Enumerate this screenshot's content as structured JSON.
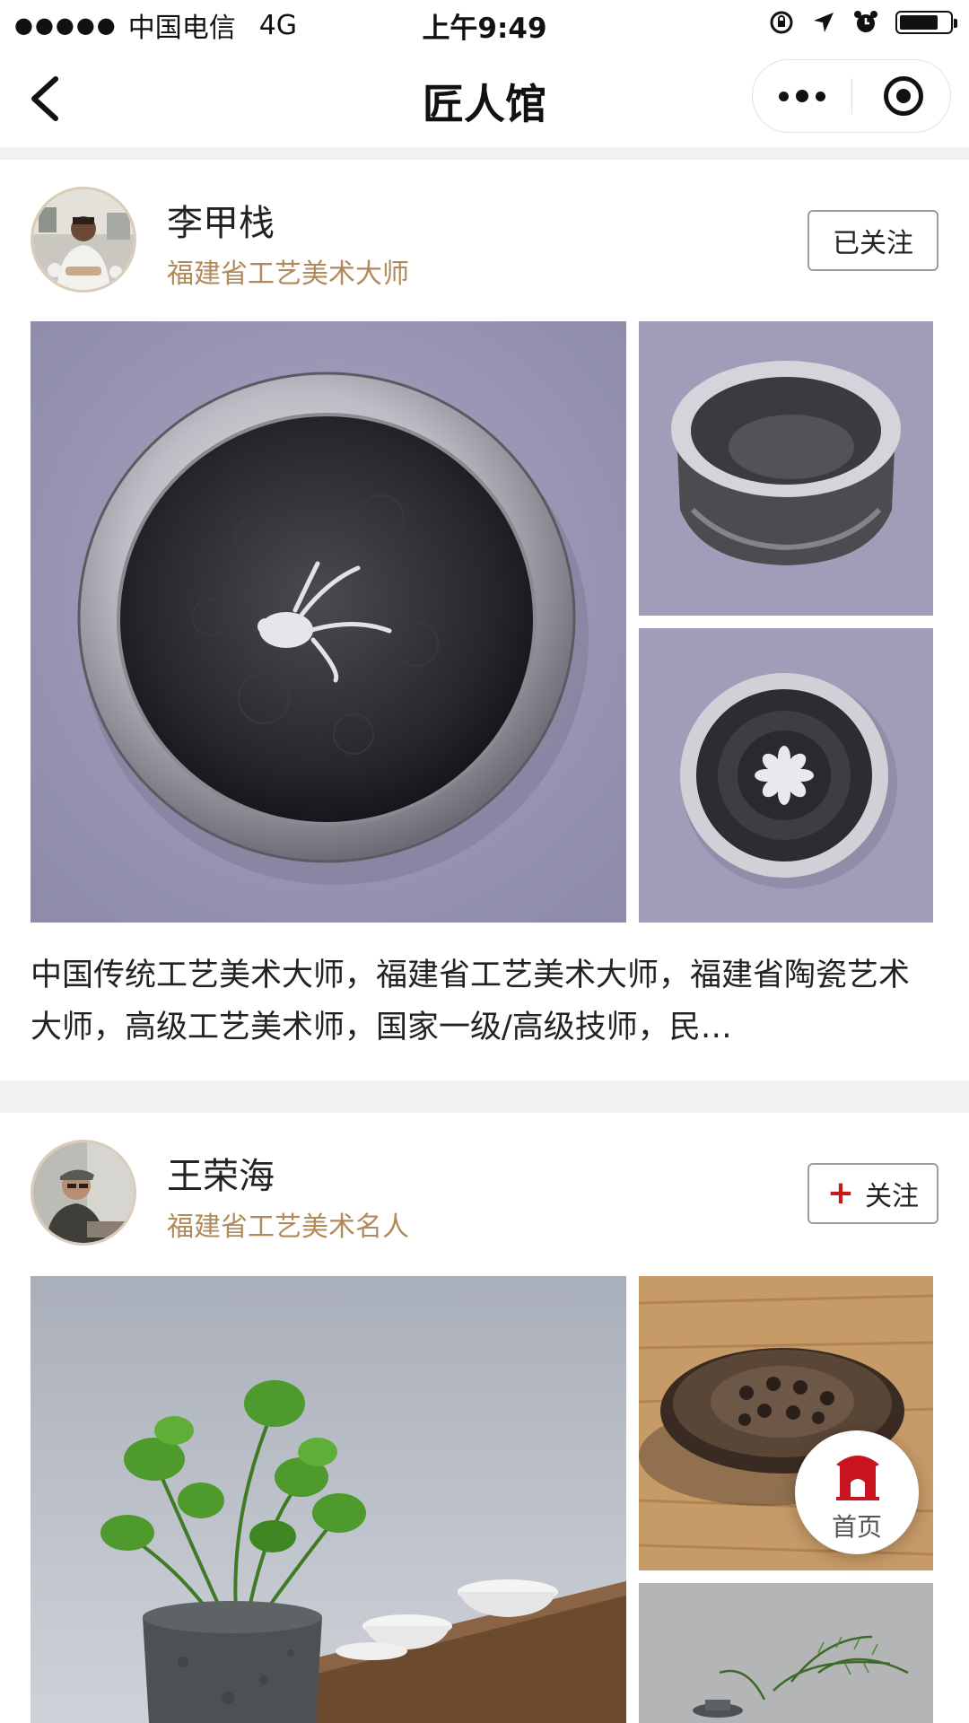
{
  "status_bar": {
    "carrier": "中国电信",
    "network": "4G",
    "time": "上午9:49",
    "battery_level": 0.7
  },
  "nav": {
    "title": "匠人馆"
  },
  "artisans": [
    {
      "name": "李甲栈",
      "title": "福建省工艺美术大师",
      "follow_label": "已关注",
      "followed": true,
      "description": "中国传统工艺美术大师，福建省工艺美术大师，福建省陶瓷艺术大师，高级工艺美术师，国家一级/高级技师，民…"
    },
    {
      "name": "王荣海",
      "title": "福建省工艺美术名人",
      "follow_label": "关注",
      "followed": false
    }
  ],
  "home_button": {
    "label": "首页",
    "color": "#c8141e"
  },
  "colors": {
    "accent": "#b08a5a",
    "follow_plus": "#c51a1a",
    "separator": "#f1f1f1"
  }
}
